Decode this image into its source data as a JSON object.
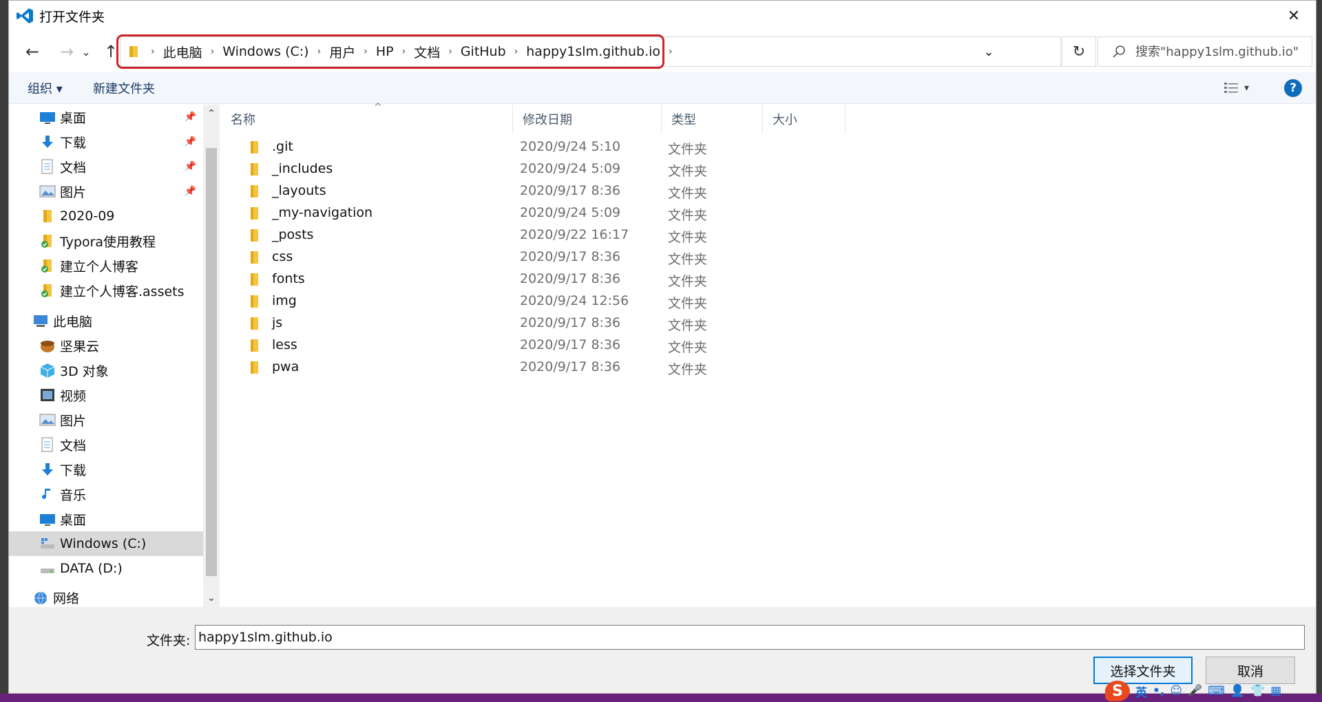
{
  "window": {
    "title": "打开文件夹",
    "close_glyph": "✕"
  },
  "nav": {
    "back_glyph": "←",
    "forward_glyph": "→",
    "recent_glyph": "⌄",
    "up_glyph": "↑",
    "refresh_glyph": "↻",
    "addr_dropdown_glyph": "⌄"
  },
  "breadcrumbs": [
    "此电脑",
    "Windows (C:)",
    "用户",
    "HP",
    "文档",
    "GitHub",
    "happy1slm.github.io"
  ],
  "crumb_sep": "›",
  "search": {
    "placeholder": "搜索\"happy1slm.github.io\""
  },
  "toolbar": {
    "organize": "组织 ▾",
    "new_folder": "新建文件夹",
    "view_dropdown": "▾",
    "help": "?"
  },
  "navpane": {
    "items": [
      {
        "label": "桌面",
        "icon": "desktop-icon",
        "pinned": true
      },
      {
        "label": "下载",
        "icon": "download-icon",
        "pinned": true
      },
      {
        "label": "文档",
        "icon": "document-icon",
        "pinned": true
      },
      {
        "label": "图片",
        "icon": "pictures-icon",
        "pinned": true
      },
      {
        "label": "2020-09",
        "icon": "folder-icon",
        "pinned": false
      },
      {
        "label": "Typora使用教程",
        "icon": "folder-synced-icon",
        "pinned": false
      },
      {
        "label": "建立个人博客",
        "icon": "folder-synced-icon",
        "pinned": false
      },
      {
        "label": "建立个人博客.assets",
        "icon": "folder-synced-icon",
        "pinned": false
      },
      {
        "label": "此电脑",
        "icon": "computer-icon",
        "pinned": false
      },
      {
        "label": "坚果云",
        "icon": "nutstore-icon",
        "pinned": false
      },
      {
        "label": "3D 对象",
        "icon": "3d-objects-icon",
        "pinned": false
      },
      {
        "label": "视频",
        "icon": "video-icon",
        "pinned": false
      },
      {
        "label": "图片",
        "icon": "pictures-icon",
        "pinned": false
      },
      {
        "label": "文档",
        "icon": "document-icon",
        "pinned": false
      },
      {
        "label": "下载",
        "icon": "download-icon",
        "pinned": false
      },
      {
        "label": "音乐",
        "icon": "music-icon",
        "pinned": false
      },
      {
        "label": "桌面",
        "icon": "desktop-icon",
        "pinned": false
      },
      {
        "label": "Windows (C:)",
        "icon": "drive-c-icon",
        "pinned": false,
        "selected": true
      },
      {
        "label": "DATA (D:)",
        "icon": "drive-icon",
        "pinned": false
      },
      {
        "label": "网络",
        "icon": "network-icon",
        "pinned": false
      }
    ],
    "pin_glyph": "📌",
    "scroll_up": "⌃",
    "scroll_down": "⌄"
  },
  "columns": {
    "name": "名称",
    "date": "修改日期",
    "type": "类型",
    "size": "大小",
    "sort_glyph": "^"
  },
  "files": [
    {
      "name": ".git",
      "date": "2020/9/24 5:10",
      "type": "文件夹"
    },
    {
      "name": "_includes",
      "date": "2020/9/24 5:09",
      "type": "文件夹"
    },
    {
      "name": "_layouts",
      "date": "2020/9/17 8:36",
      "type": "文件夹"
    },
    {
      "name": "_my-navigation",
      "date": "2020/9/24 5:09",
      "type": "文件夹"
    },
    {
      "name": "_posts",
      "date": "2020/9/22 16:17",
      "type": "文件夹"
    },
    {
      "name": "css",
      "date": "2020/9/17 8:36",
      "type": "文件夹"
    },
    {
      "name": "fonts",
      "date": "2020/9/17 8:36",
      "type": "文件夹"
    },
    {
      "name": "img",
      "date": "2020/9/24 12:56",
      "type": "文件夹"
    },
    {
      "name": "js",
      "date": "2020/9/17 8:36",
      "type": "文件夹"
    },
    {
      "name": "less",
      "date": "2020/9/17 8:36",
      "type": "文件夹"
    },
    {
      "name": "pwa",
      "date": "2020/9/17 8:36",
      "type": "文件夹"
    }
  ],
  "bottom": {
    "folder_label": "文件夹:",
    "folder_value": "happy1slm.github.io",
    "select_button": "选择文件夹",
    "cancel_button": "取消"
  },
  "ime": {
    "logo": "S",
    "lang": "英",
    "punct": "•,"
  },
  "colors": {
    "accent": "#0078d7",
    "highlight_box": "#c8262b",
    "folder_yellow": "#f4c542",
    "taskbar": "#68217a"
  }
}
